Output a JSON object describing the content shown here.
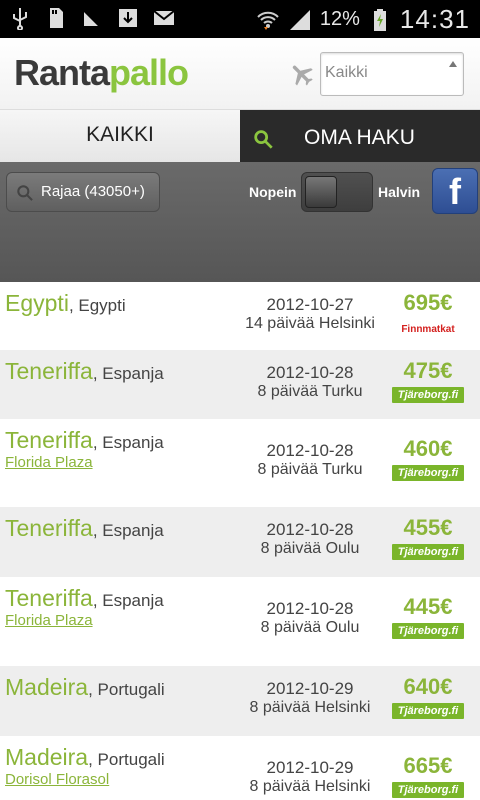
{
  "status_bar": {
    "battery_pct": "12%",
    "time": "14:31"
  },
  "header": {
    "logo_dark": "Ranta",
    "logo_green": "pallo",
    "search_placeholder": "Kaikki"
  },
  "tabs": {
    "all": "KAIKKI",
    "own_search": "OMA HAKU"
  },
  "filter": {
    "filter_label": "Rajaa (43050+)",
    "fastest": "Nopein",
    "cheapest": "Halvin",
    "facebook": "f"
  },
  "trips": [
    {
      "city": "Egypti",
      "country": ", Egypti",
      "hotel": "",
      "date": "2012-10-27",
      "length": "14 päivää Helsinki",
      "price": "695€",
      "operator": "Finnmatkat"
    },
    {
      "city": "Teneriffa",
      "country": ", Espanja",
      "hotel": "",
      "date": "2012-10-28",
      "length": "8 päivää Turku",
      "price": "475€",
      "operator": "Tjäreborg.fi"
    },
    {
      "city": "Teneriffa",
      "country": ", Espanja",
      "hotel": "Florida Plaza",
      "date": "2012-10-28",
      "length": "8 päivää Turku",
      "price": "460€",
      "operator": "Tjäreborg.fi"
    },
    {
      "city": "Teneriffa",
      "country": ", Espanja",
      "hotel": "",
      "date": "2012-10-28",
      "length": "8 päivää Oulu",
      "price": "455€",
      "operator": "Tjäreborg.fi"
    },
    {
      "city": "Teneriffa",
      "country": ", Espanja",
      "hotel": "Florida Plaza",
      "date": "2012-10-28",
      "length": "8 päivää Oulu",
      "price": "445€",
      "operator": "Tjäreborg.fi"
    },
    {
      "city": "Madeira",
      "country": ", Portugali",
      "hotel": "",
      "date": "2012-10-29",
      "length": "8 päivää Helsinki",
      "price": "640€",
      "operator": "Tjäreborg.fi"
    },
    {
      "city": "Madeira",
      "country": ", Portugali",
      "hotel": "Dorisol Florasol",
      "date": "2012-10-29",
      "length": "8 päivää Helsinki",
      "price": "665€",
      "operator": "Tjäreborg.fi"
    }
  ],
  "colors": {
    "accent_green": "#8bb53a",
    "tjareborg_green": "#7ab52a",
    "finnmatkat_red": "#d4211f"
  }
}
